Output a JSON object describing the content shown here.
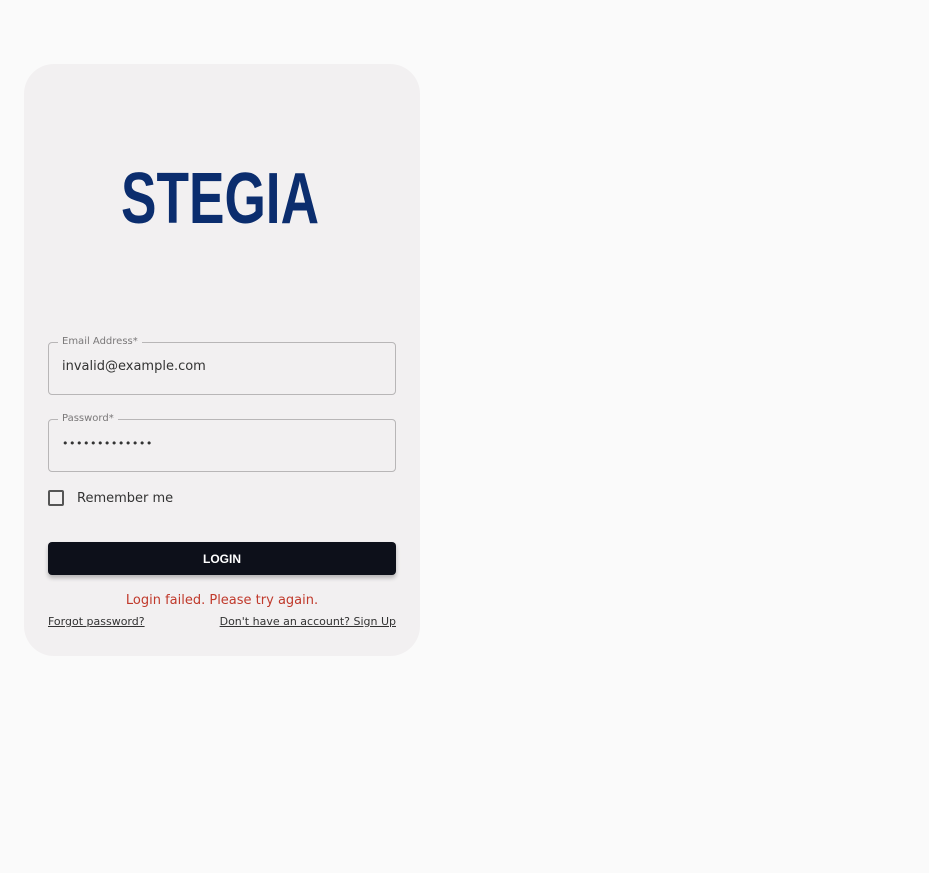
{
  "brand": {
    "logo_text": "STEGIA",
    "logo_color": "#0b2d6e"
  },
  "form": {
    "email": {
      "label": "Email Address",
      "required_mark": "*",
      "value": "invalid@example.com"
    },
    "password": {
      "label": "Password",
      "required_mark": "*",
      "value": "•••••••••••••"
    },
    "remember_me": {
      "label": "Remember me",
      "checked": false
    },
    "login_button_label": "LOGIN",
    "error_message": "Login failed. Please try again.",
    "forgot_password_link": "Forgot password?",
    "signup_link": "Don't have an account? Sign Up"
  },
  "colors": {
    "page_background": "#fafafa",
    "card_background": "#f2f0f1",
    "button_background": "#0d101a",
    "error": "#c0392b"
  }
}
